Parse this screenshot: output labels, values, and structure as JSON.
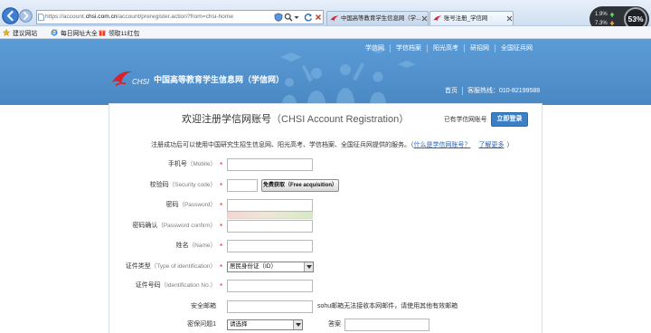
{
  "browser": {
    "url_prefix": "https://account.",
    "url_domain": "chsi.com.cn",
    "url_path": "/account/preregister.action?from=chsi-home",
    "tabs": [
      {
        "label": "中国高等教育学生信息网（学...",
        "active": false
      },
      {
        "label": "账号注册_学信网",
        "active": true
      }
    ],
    "monitor": {
      "upload": "1.9%",
      "download": "7.3%",
      "usage": "53%"
    }
  },
  "favorites": [
    {
      "label": "建议网站",
      "icon": "star-icon"
    },
    {
      "label": "每日网址大全",
      "icon": "ie-icon"
    },
    {
      "label": "领取11红包",
      "icon": "gift-icon"
    }
  ],
  "header": {
    "nav": [
      "学信网",
      "学信档案",
      "阳光高考",
      "研招网",
      "全国征兵网"
    ],
    "logo_en": "CHSI",
    "logo_cn": "中国高等教育学生信息网（学信网）",
    "home": "首页",
    "hotline": "客服热线：010-82199588"
  },
  "page": {
    "title": "欢迎注册学信网账号",
    "title_en": "（CHSI Account Registration）",
    "have_account": "已有学信网账号",
    "login_button": "立即登录",
    "intro": "注册成功后可以使用中国研究生招生信息网、阳光高考、学信档案、全国征兵网提供的服务。（",
    "intro_link_what": "什么是学信网账号？",
    "intro_link_more": "了解更多",
    "intro_close": "）"
  },
  "form": {
    "required_mark": "*",
    "fields": [
      {
        "label": "手机号",
        "label_en": "（Mobile）",
        "required": true,
        "value": ""
      },
      {
        "label": "校验码",
        "label_en": "（Security code）",
        "required": true,
        "value": "",
        "button": "免费获取（Free acquisition）"
      },
      {
        "label": "密码",
        "label_en": "（Password）",
        "required": true,
        "value": ""
      },
      {
        "label": "密码确认",
        "label_en": "（Password confirm）",
        "required": true,
        "value": ""
      },
      {
        "label": "姓名",
        "label_en": "（Name）",
        "required": true,
        "value": ""
      },
      {
        "label": "证件类型",
        "label_en": "（Type of identification）",
        "required": true,
        "selected": "居民身份证（ID）"
      },
      {
        "label": "证件号码",
        "label_en": "（Identification No.）",
        "required": true,
        "value": ""
      },
      {
        "label": "安全邮箱",
        "required": false,
        "value": "",
        "note": "sohu邮箱无法接收本网邮件，请使用其他有效邮箱"
      },
      {
        "label": "密保问题1",
        "required": false,
        "selected": "请选择",
        "answer_label": "答案",
        "answer_value": ""
      }
    ]
  },
  "colors": {
    "header": "#4f8fcb",
    "login_button": "#3b80c6",
    "required": "#e02020",
    "link": "#2a62b8",
    "monitor": "#2f3338"
  }
}
